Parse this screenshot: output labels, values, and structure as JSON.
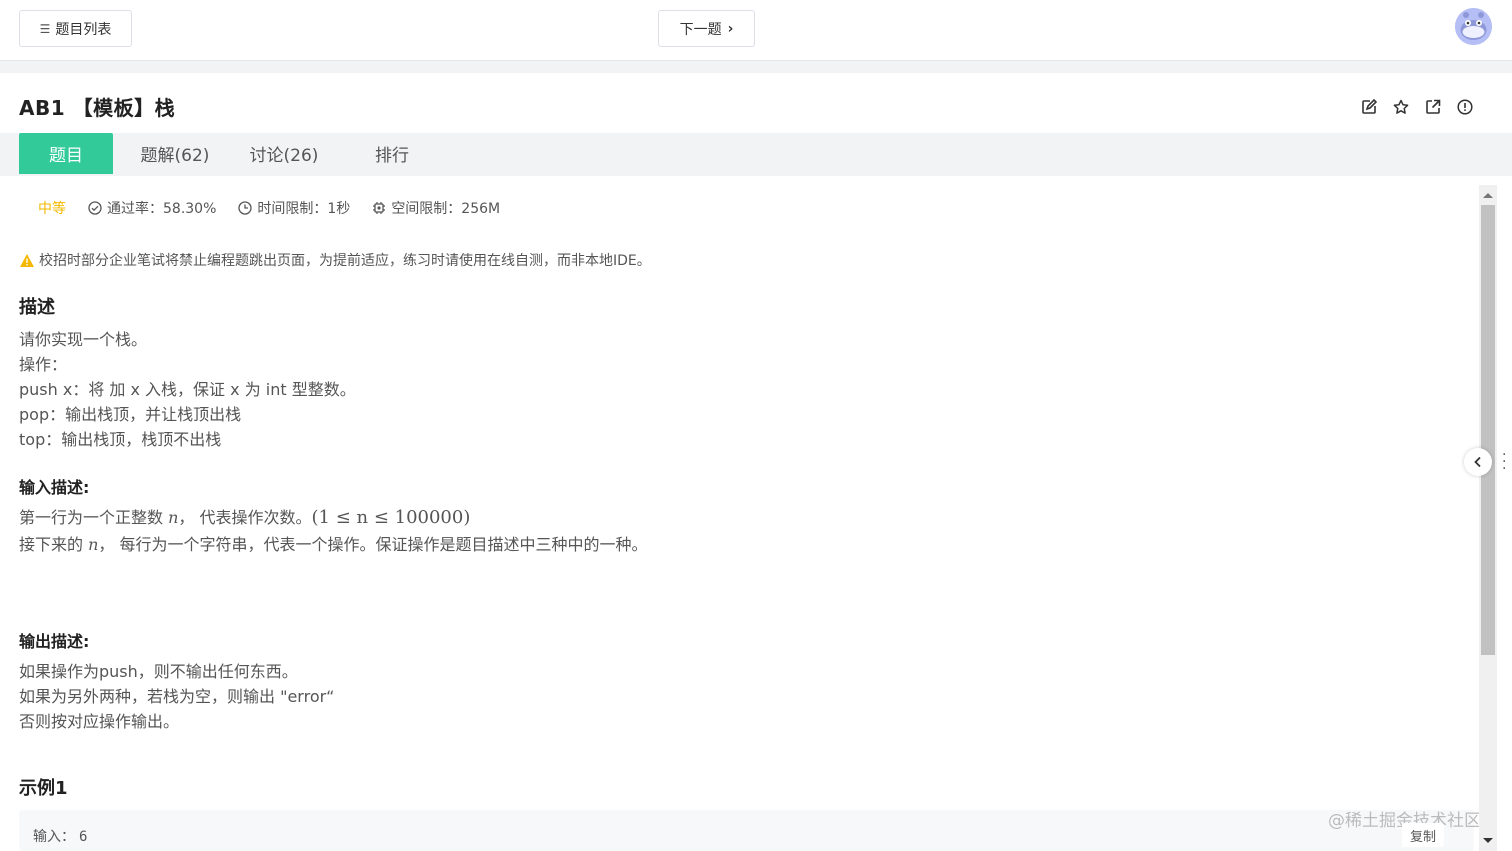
{
  "topbar": {
    "list_label": "题目列表",
    "next_label": "下一题"
  },
  "problem": {
    "title": "AB1  【模板】栈"
  },
  "tabs": [
    {
      "label": "题目",
      "active": true
    },
    {
      "label": "题解(62)",
      "active": false
    },
    {
      "label": "讨论(26)",
      "active": false
    },
    {
      "label": "排行",
      "active": false
    }
  ],
  "meta": {
    "difficulty": "中等",
    "pass_rate": "通过率：58.30%",
    "time_limit": "时间限制：1秒",
    "space_limit": "空间限制：256M"
  },
  "warning": "校招时部分企业笔试将禁止编程题跳出页面，为提前适应，练习时请使用在线自测，而非本地IDE。",
  "description": {
    "heading": "描述",
    "lines": [
      "请你实现一个栈。",
      "操作：",
      "push x：将 加 x 入栈，保证 x 为 int 型整数。",
      "pop：输出栈顶，并让栈顶出栈",
      "top：输出栈顶，栈顶不出栈"
    ]
  },
  "input": {
    "heading": "输入描述:",
    "line1_pre": "第一行为一个正整数 ",
    "line1_var": "n",
    "line1_mid": "， 代表操作次数。",
    "line1_math": "(1 ≤ n ≤ 100000)",
    "line2_pre": "接下来的 ",
    "line2_var": "n",
    "line2_post": "， 每行为一个字符串，代表一个操作。保证操作是题目描述中三种中的一种。"
  },
  "output": {
    "heading": "输出描述:",
    "lines": [
      "如果操作为push，则不输出任何东西。",
      "如果为另外两种，若栈为空，则输出 \"error“",
      "否则按对应操作输出。"
    ]
  },
  "example": {
    "heading": "示例1",
    "input_label": "输入：",
    "input_value": "6",
    "copy_label": "复制"
  },
  "watermark": "@稀土掘金技术社区",
  "colors": {
    "accent": "#32ca99",
    "difficulty": "#f5b800",
    "warning": "#f5b800"
  }
}
